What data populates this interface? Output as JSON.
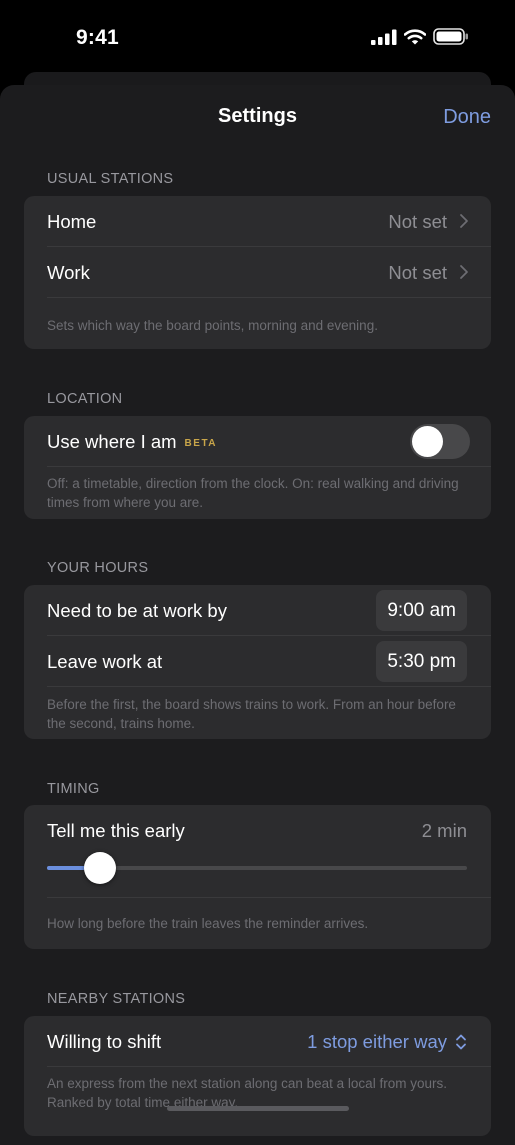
{
  "status_bar": {
    "time": "9:41"
  },
  "nav": {
    "title": "Settings",
    "done_label": "Done"
  },
  "usual_stations": {
    "header": "USUAL STATIONS",
    "home_label": "Home",
    "home_value": "Not set",
    "work_label": "Work",
    "work_value": "Not set",
    "footnote": "Sets which way the board points, morning and evening."
  },
  "location": {
    "header": "LOCATION",
    "label": "Use where I am",
    "badge": "BETA",
    "toggle_on": false,
    "footnote": "Off: a timetable, direction from the clock. On: real walking and driving times from where you are."
  },
  "your_hours": {
    "header": "YOUR HOURS",
    "arrive_label": "Need to be at work by",
    "arrive_value": "9:00 am",
    "leave_label": "Leave work at",
    "leave_value": "5:30 pm",
    "footnote": "Before the first, the board shows trains to work. From an hour before the second, trains home."
  },
  "timing": {
    "header": "TIMING",
    "label": "Tell me this early",
    "value": "2 min",
    "slider_fraction": 0.127,
    "footnote": "How long before the train leaves the reminder arrives."
  },
  "nearby_stations": {
    "header": "NEARBY STATIONS",
    "label": "Willing to shift",
    "value": "1 stop either way",
    "footnote": "An express from the next station along can beat a local from yours. Ranked by total time either way."
  },
  "icons": {
    "signal": "cellular-signal-icon",
    "wifi": "wifi-icon",
    "battery": "battery-icon",
    "chevron": "chevron-right-icon",
    "stepper": "chevron-up-down-icon"
  },
  "colors": {
    "accent": "#7e9ce0",
    "beta_badge": "#c9a64a",
    "group_bg": "#2c2c2e",
    "sheet_bg": "#1c1c1e"
  }
}
